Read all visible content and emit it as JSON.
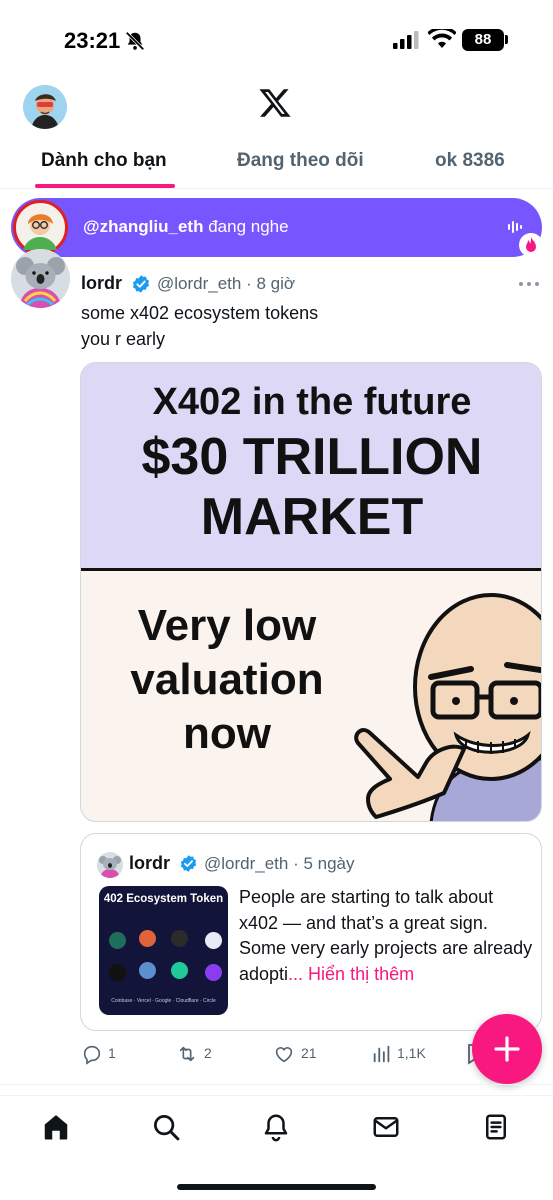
{
  "status_bar": {
    "time": "23:21",
    "battery": "88",
    "icons": [
      "bell-muted-icon",
      "cellular-signal-icon",
      "wifi-icon",
      "battery-icon"
    ]
  },
  "header": {
    "logo": "x-logo-icon"
  },
  "tabs": [
    {
      "label": "Dành cho bạn",
      "active": true
    },
    {
      "label": "Đang theo dõi",
      "active": false
    },
    {
      "label": "ok 8386",
      "active": false
    }
  ],
  "spaces": {
    "handle": "@zhangliu_eth",
    "status": "đang nghe",
    "color": "#7856ff"
  },
  "post": {
    "name": "lordr",
    "handle_time": "@lordr_eth · 8 giờ",
    "text_lines": [
      "some x402 ecosystem tokens",
      "you r early"
    ],
    "media": {
      "line1": "X402 in the future",
      "line2": "$30 TRILLION",
      "line3": "MARKET",
      "left_line1": "Very low",
      "left_line2": "valuation",
      "left_line3": "now"
    },
    "quote": {
      "name": "lordr",
      "handle_time": "@lordr_eth · 5 ngày",
      "thumb_title": "402 Ecosystem Token",
      "thumb_footer": "Coinbase · Vercel · Google · Cloudflare · Circle",
      "text": "People are starting to talk about x402 — and that’s a great sign. Some very early projects are already adopti",
      "show_more": "... Hiển thị thêm"
    },
    "stats": {
      "replies": "1",
      "reposts": "2",
      "likes": "21",
      "views": "1,1K"
    }
  },
  "colors": {
    "accent": "#f91880",
    "verified": "#1d9bf0",
    "secondary_text": "#536471"
  },
  "bottom_nav": [
    "home-icon",
    "search-icon",
    "notifications-icon",
    "messages-icon",
    "grok-icon"
  ]
}
